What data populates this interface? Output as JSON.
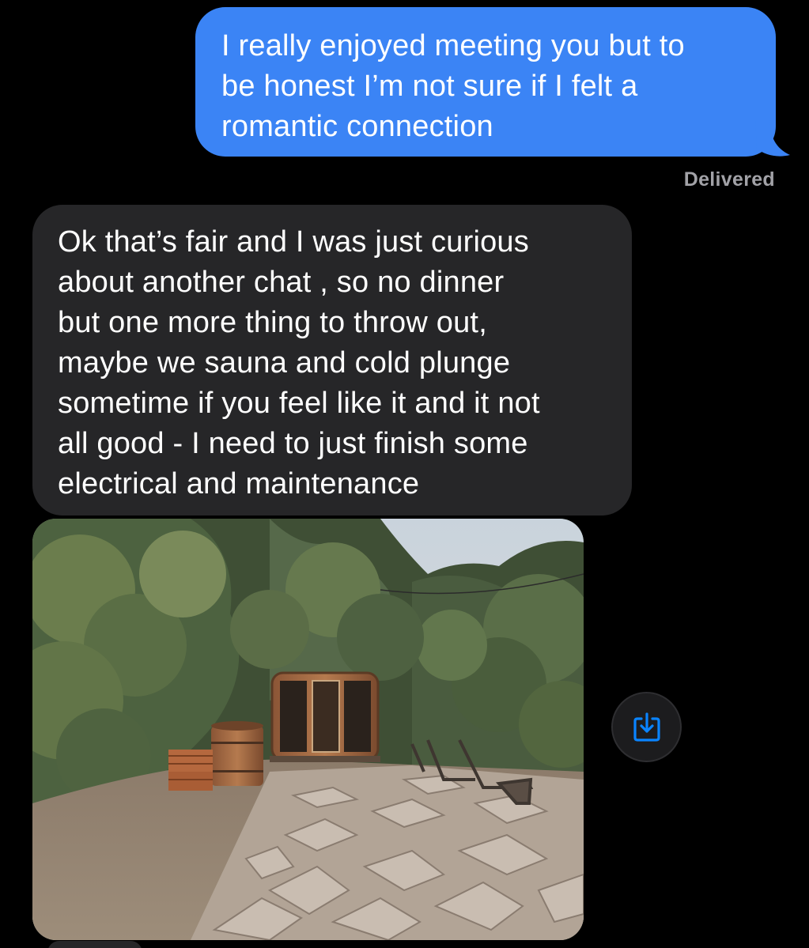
{
  "conversation": {
    "messages": [
      {
        "direction": "outgoing",
        "text": "I really enjoyed meeting you but to\nbe honest I’m not sure if I felt a\nromantic connection",
        "status": "Delivered"
      },
      {
        "direction": "incoming",
        "text": "Ok that’s fair and I was just curious\nabout another chat , so no dinner\nbut one more thing to throw out,\nmaybe we sauna and cold plunge\nsometime if you feel like it and it not\nall good - I need to just finish some\nelectrical and maintenance"
      },
      {
        "direction": "incoming",
        "type": "photo",
        "icon": "save-download-icon"
      }
    ]
  },
  "colors": {
    "background": "#000000",
    "outgoing_bubble": "#3b84f5",
    "incoming_bubble": "#262628",
    "status_text": "#a2a2a7",
    "accent": "#0a84ff"
  }
}
